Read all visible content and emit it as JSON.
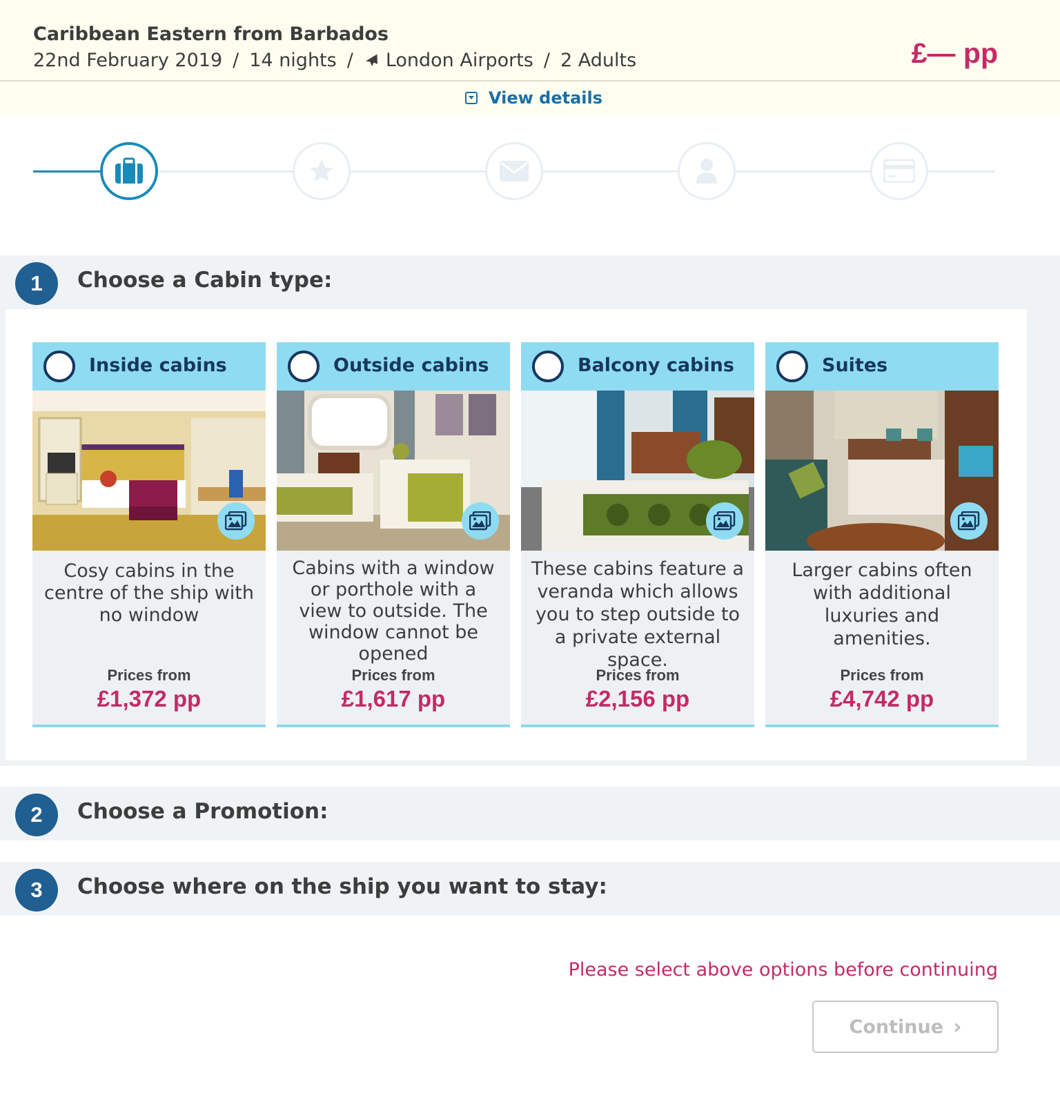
{
  "header": {
    "title": "Caribbean Eastern from Barbados",
    "date": "22nd February 2019",
    "nights": "14 nights",
    "airport": "London Airports",
    "passengers": "2 Adults",
    "separator": "/",
    "price": "£— pp",
    "view_details": "View details"
  },
  "stepper": {
    "steps": [
      {
        "icon": "suitcase-icon",
        "state": "active"
      },
      {
        "icon": "star-icon",
        "state": "inactive"
      },
      {
        "icon": "envelope-icon",
        "state": "inactive"
      },
      {
        "icon": "person-icon",
        "state": "inactive"
      },
      {
        "icon": "credit-card-icon",
        "state": "inactive"
      }
    ]
  },
  "sections": [
    {
      "number": "1",
      "title": "Choose a Cabin type:"
    },
    {
      "number": "2",
      "title": "Choose a Promotion:"
    },
    {
      "number": "3",
      "title": "Choose where on the ship you want to stay:"
    }
  ],
  "cabins": [
    {
      "label": "Inside cabins",
      "description": "Cosy cabins in the centre of the ship with no window",
      "prices_from": "Prices from",
      "price": "£1,372 pp"
    },
    {
      "label": "Outside cabins",
      "description": "Cabins with a window or porthole with a view to outside. The window cannot be opened",
      "prices_from": "Prices from",
      "price": "£1,617 pp"
    },
    {
      "label": "Balcony cabins",
      "description": "These cabins feature a veranda which allows you to step outside to a private external space.",
      "prices_from": "Prices from",
      "price": "£2,156 pp"
    },
    {
      "label": "Suites",
      "description": "Larger cabins often with additional luxuries and amenities.",
      "prices_from": "Prices from",
      "price": "£4,742 pp"
    }
  ],
  "footer": {
    "warning": "Please select above options before continuing",
    "continue_label": "Continue"
  },
  "colors": {
    "accent_blue": "#1a8ab8",
    "navy": "#1f5f92",
    "price_pink": "#c42a66",
    "card_header": "#8fdcf2"
  }
}
